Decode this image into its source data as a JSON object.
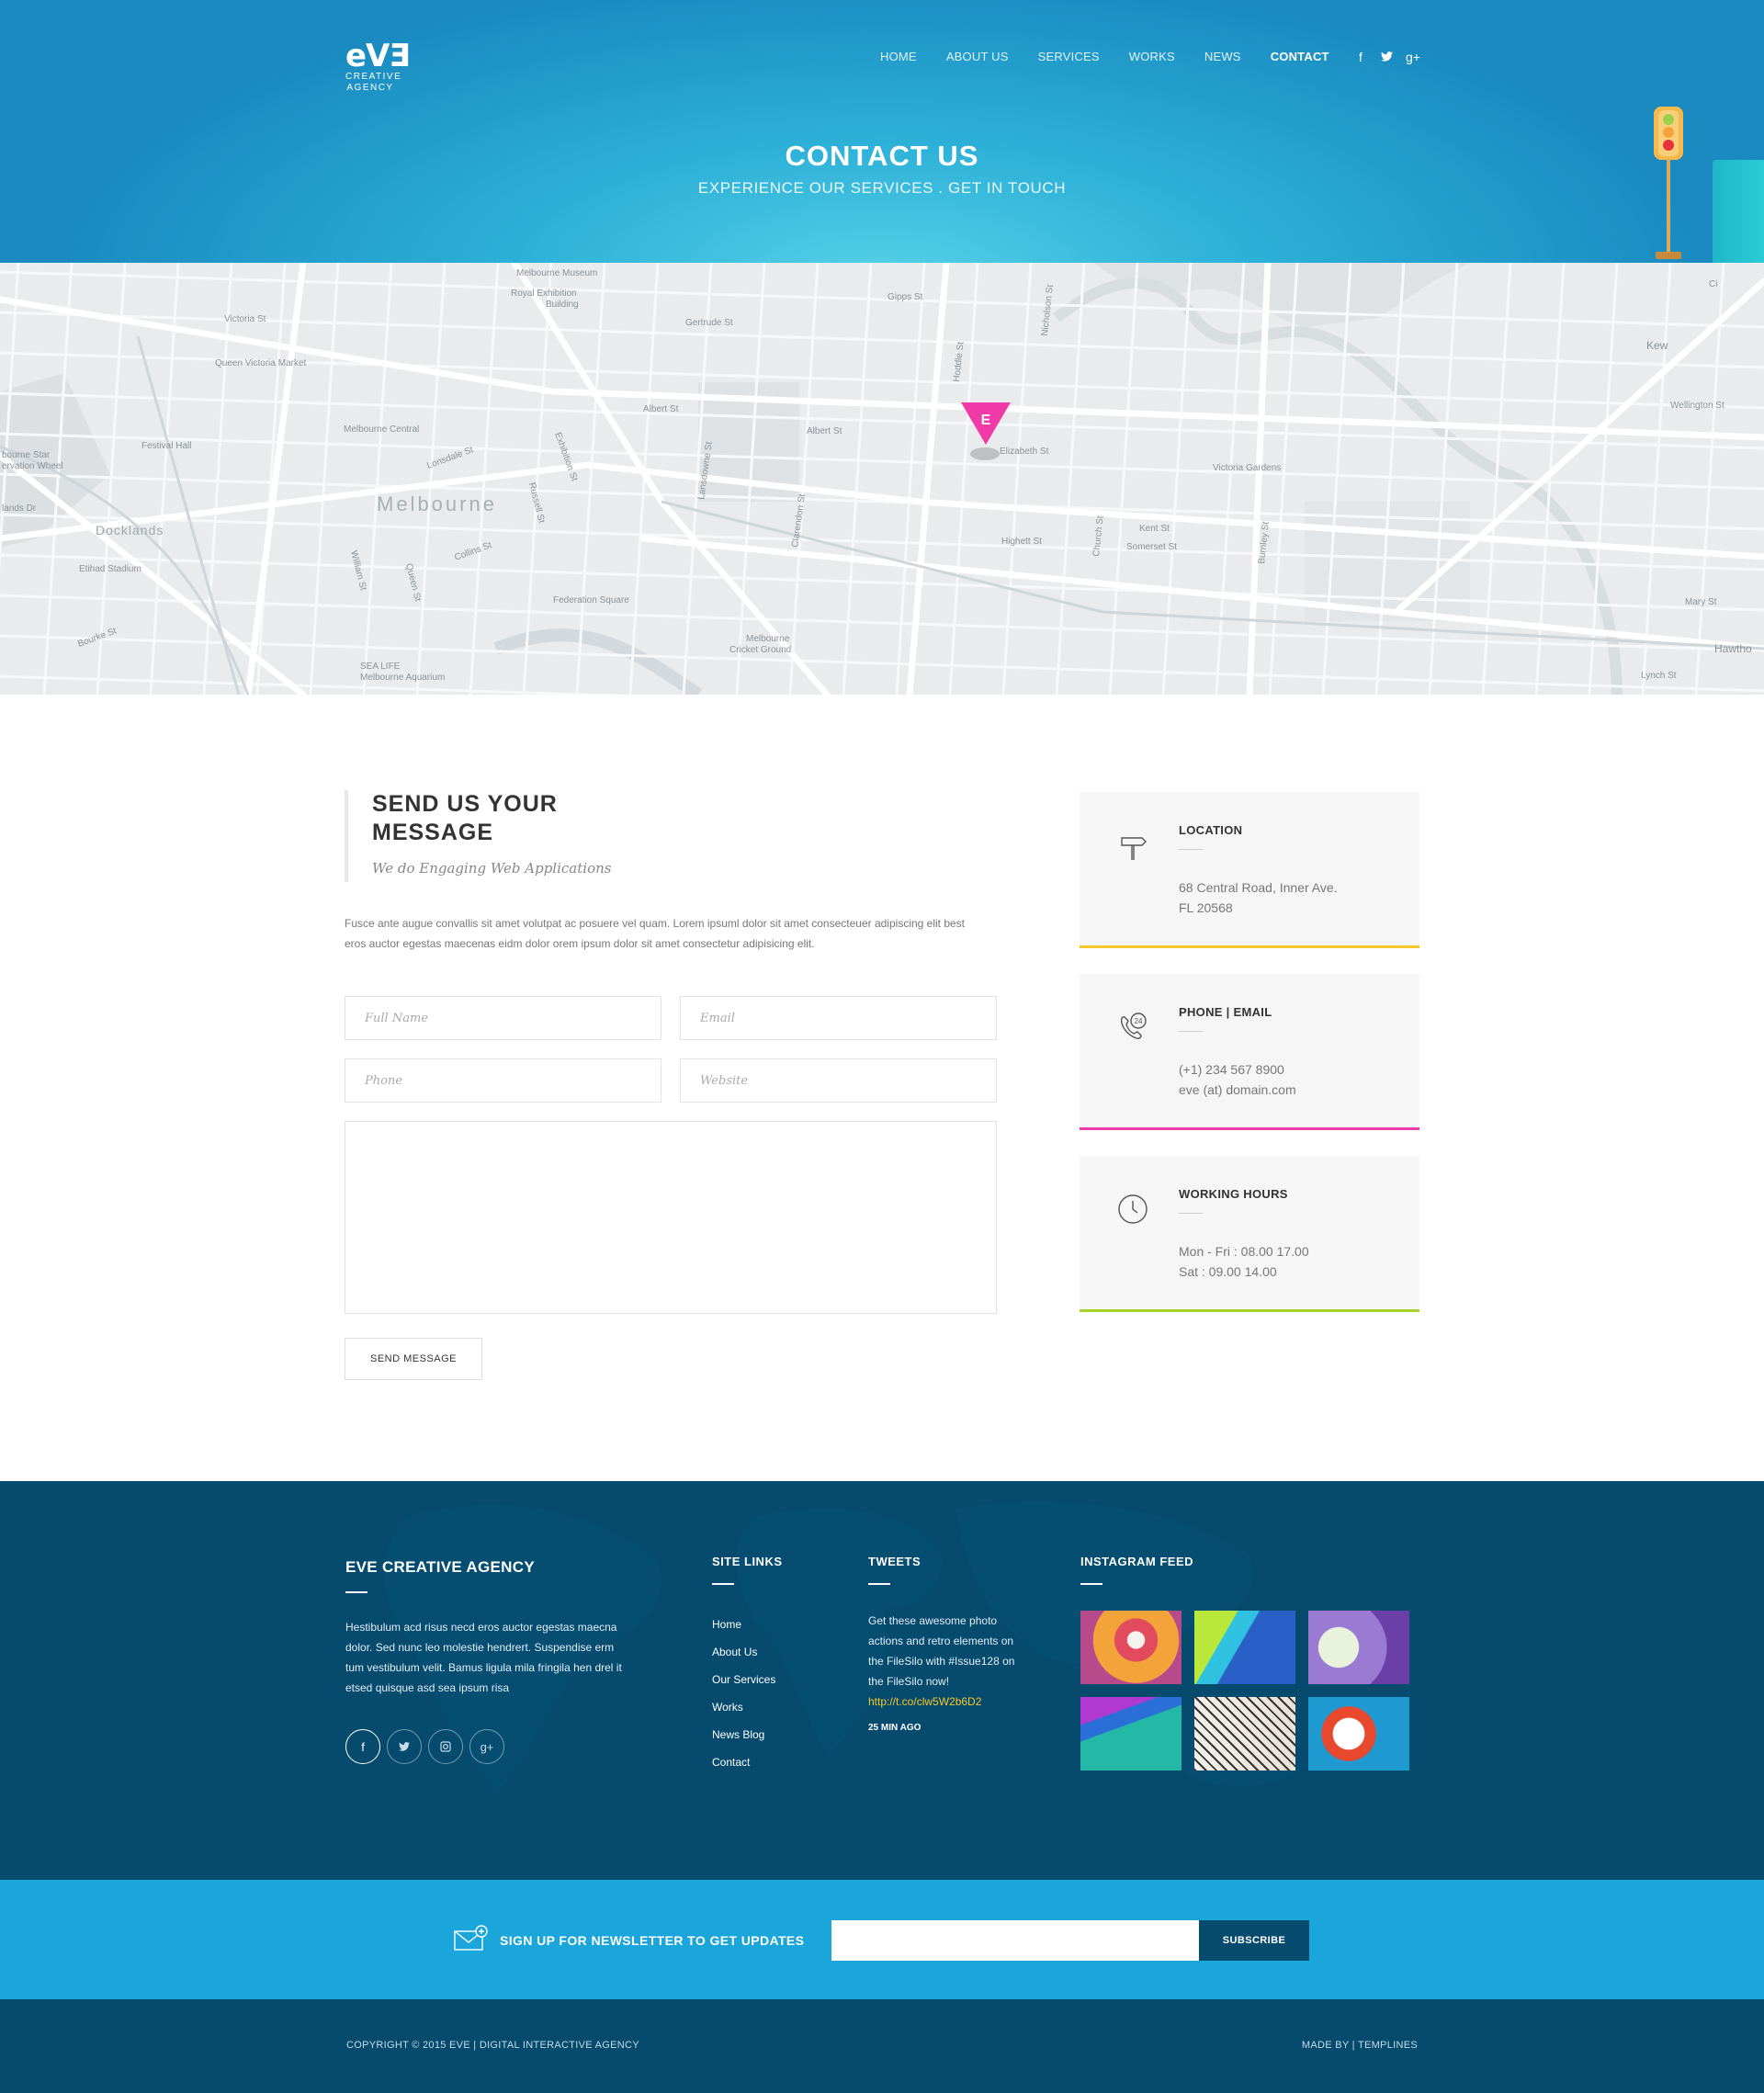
{
  "header": {
    "logo_mark": "eVƎ",
    "logo_line1": "CREATIVE",
    "logo_line2": "AGENCY",
    "nav": [
      "HOME",
      "ABOUT US",
      "SERVICES",
      "WORKS",
      "NEWS",
      "CONTACT"
    ],
    "active_nav": "CONTACT",
    "social_icons": [
      "facebook-icon",
      "twitter-icon",
      "google-plus-icon"
    ],
    "title": "CONTACT US",
    "subtitle": "EXPERIENCE OUR SERVICES . GET IN TOUCH"
  },
  "map": {
    "marker_letter": "E",
    "marker_color": "#f03aa8",
    "labels": {
      "city": "Melbourne",
      "docklands": "Docklands",
      "museum": "Melbourne Museum",
      "exhibition_1": "Royal Exhibition",
      "exhibition_2": "Building",
      "qvm": "Queen Victoria Market",
      "central": "Melbourne Central",
      "festival": "Festival Hall",
      "etihad": "Etihad Stadium",
      "fedsq": "Federation Square",
      "sealife_1": "SEA LIFE",
      "sealife_2": "Melbourne Aquarium",
      "mcg_1": "Melbourne",
      "mcg_2": "Cricket Ground",
      "vicgardens": "Victoria Gardens",
      "kew": "Kew",
      "hawthorn": "Hawtho",
      "victoria_st": "Victoria St",
      "gertrude_st": "Gertrude St",
      "gipps_st": "Gipps St",
      "albert_st_1": "Albert St",
      "albert_st_2": "Albert St",
      "elizabeth_st": "Elizabeth St",
      "highett_st": "Highett St",
      "kent_st": "Kent St",
      "somerset_st": "Somerset St",
      "wellington_st": "Wellington St",
      "mary_st": "Mary St",
      "lonsdale_st": "Lonsdale St",
      "collins_st": "Collins St",
      "bourke_st": "Bourke St",
      "lansdowne_st": "Lansdowne St",
      "hoddle_st": "Hoddle St",
      "nicholson_st": "Nicholson St",
      "church_st": "Church St",
      "burnley_st": "Burnley St",
      "exhibition_st": "Exhibition St",
      "russell_st": "Russell St",
      "queen_st": "Queen St",
      "william_st": "William St",
      "clarendon_st": "Clarendon St",
      "lynch_st": "Lynch St",
      "star_1": "bourne Star",
      "star_2": "ervation Wheel",
      "lands_dr": "lands Dr",
      "city_rd": "Ci"
    }
  },
  "form": {
    "heading": "SEND US YOUR MESSAGE",
    "tagline": "We do Engaging Web Applications",
    "intro": "Fusce ante augue convallis sit amet volutpat ac posuere vel quam. Lorem ipsuml dolor sit amet consecteuer adipiscing elit best eros auctor egestas maecenas eidm dolor orem ipsum dolor sit amet consectetur adipisicing elit.",
    "placeholders": {
      "name": "Full Name",
      "email": "Email",
      "phone": "Phone",
      "website": "Website"
    },
    "submit_label": "SEND MESSAGE"
  },
  "info": [
    {
      "icon": "signpost-icon",
      "title": "LOCATION",
      "line1": "68 Central Road, Inner Ave.",
      "line2": "FL 20568",
      "accent": "#f4c82a"
    },
    {
      "icon": "phone-24-icon",
      "title": "PHONE | EMAIL",
      "line1": "(+1) 234 567 8900",
      "line2": "eve (at) domain.com",
      "accent": "#f03aa8"
    },
    {
      "icon": "clock-icon",
      "title": "WORKING HOURS",
      "line1": "Mon - Fri : 08.00 17.00",
      "line2": "Sat : 09.00  14.00",
      "accent": "#a8d12c"
    }
  ],
  "footer": {
    "about": {
      "title": "EVE CREATIVE AGENCY",
      "text": "Hestibulum acd risus necd eros auctor egestas maecna dolor. Sed nunc leo molestie hendrert. Suspendise erm tum vestibulum velit. Bamus ligula mila fringila hen drel it etsed quisque asd sea ipsum risa",
      "social_icons": [
        "facebook-icon",
        "twitter-icon",
        "instagram-icon",
        "google-plus-icon"
      ]
    },
    "site_links": {
      "title": "SITE LINKS",
      "items": [
        "Home",
        "About Us",
        "Our Services",
        "Works",
        "News Blog",
        "Contact"
      ]
    },
    "tweets": {
      "title": "TWEETS",
      "text": "Get these awesome photo actions and retro elements on the FileSilo with #Issue128 on the FileSilo now!",
      "link": "http://t.co/clw5W2b6D2",
      "time": "25 MIN AGO"
    },
    "instagram": {
      "title": "INSTAGRAM FEED",
      "tiles": [
        "#e24a5e",
        "#2a5fc7",
        "#9a7ad2",
        "#23b9a6",
        "#e8e3d8",
        "#1e9ad0"
      ]
    }
  },
  "newsletter": {
    "text": "SIGN UP FOR NEWSLETTER TO GET UPDATES",
    "input_value": "",
    "button": "SUBSCRIBE"
  },
  "bottom": {
    "copyright": "COPYRIGHT © 2015 EVE   |   DIGITAL INTERACTIVE AGENCY",
    "made_by": "MADE BY | TEMPLINES"
  },
  "colors": {
    "hero_blue": "#1a8ac0",
    "footer_navy": "#064a6e",
    "newsletter_blue": "#1aa5db",
    "tweet_link": "#f6c92a"
  }
}
